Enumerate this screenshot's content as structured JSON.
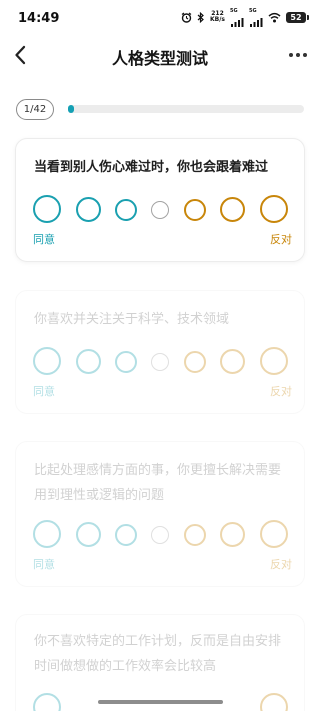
{
  "status_bar": {
    "time": "14:49",
    "net_speed_value": "212",
    "net_speed_unit": "KB/s",
    "sig1_tag": "5G",
    "sig2_tag": "5G",
    "battery": "52"
  },
  "header": {
    "title": "人格类型测试",
    "back_icon": "chevron-left-icon",
    "more_icon": "more-horizontal-icon"
  },
  "progress": {
    "label": "1/42",
    "fraction": 0.024
  },
  "colors": {
    "agree": "#1aa0b0",
    "neutral": "#a3a3a3",
    "disagree": "#c8860a"
  },
  "questions": [
    {
      "text": "当看到别人伤心难过时，你也会跟着难过",
      "agree": "同意",
      "disagree": "反对"
    },
    {
      "text": "你喜欢并关注关于科学、技术领域",
      "agree": "同意",
      "disagree": "反对"
    },
    {
      "text": "比起处理感情方面的事，你更擅长解决需要用到理性或逻辑的问题",
      "agree": "同意",
      "disagree": "反对"
    },
    {
      "text": "你不喜欢特定的工作计划，反而是自由安排时间做想做的工作效率会比较高",
      "agree": "",
      "disagree": ""
    }
  ]
}
